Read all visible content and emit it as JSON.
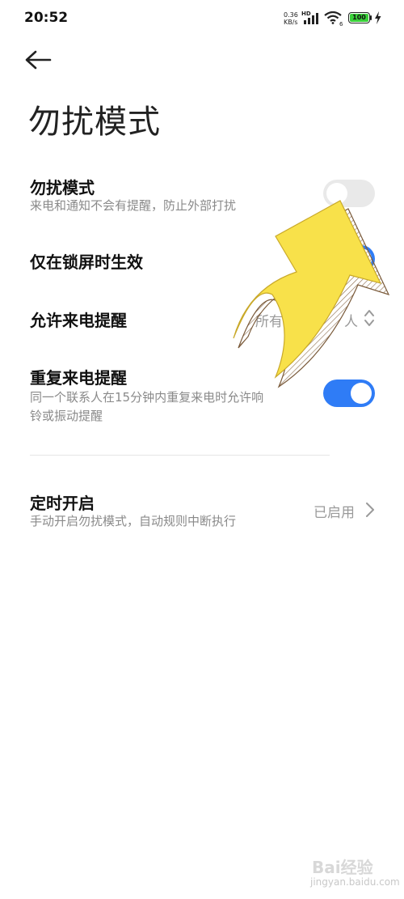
{
  "status": {
    "time": "20:52",
    "net_speed_value": "0.36",
    "net_speed_unit": "KB/s",
    "hd_label": "HD",
    "wifi_label": "6",
    "battery": "100"
  },
  "header": {
    "title": "勿扰模式"
  },
  "settings": {
    "dnd": {
      "title": "勿扰模式",
      "subtitle": "来电和通知不会有提醒，防止外部打扰",
      "enabled": false
    },
    "lockscreen": {
      "title": "仅在锁屏时生效",
      "enabled": true
    },
    "allow_calls": {
      "title": "允许来电提醒",
      "value_visible_start": "所有",
      "value_visible_end": "人"
    },
    "repeat_calls": {
      "title": "重复来电提醒",
      "subtitle_line1": "同一个联系人在15分钟内重复来电时允许响",
      "subtitle_line2": "铃或振动提醒",
      "enabled": true
    },
    "schedule": {
      "title": "定时开启",
      "subtitle": "手动开启勿扰模式，自动规则中断执行",
      "value": "已启用"
    }
  },
  "overlay": {
    "arrow_color": "#f8e14a"
  },
  "watermark": {
    "brand": "Bai经验",
    "url": "jingyan.baidu.com"
  },
  "colors": {
    "accent": "#2f7cf6",
    "toggle_off": "#e9e9e9"
  }
}
